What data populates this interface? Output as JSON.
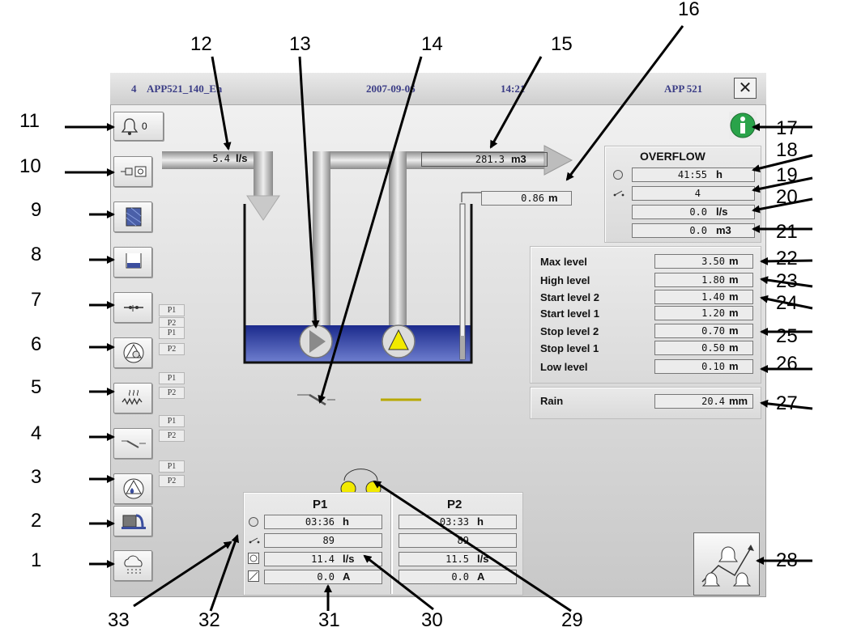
{
  "titlebar": {
    "station": "4",
    "app_name": "APP521_140_En",
    "date": "2007-09-06",
    "time": "14:21",
    "model": "APP 521",
    "close_symbol": "✕"
  },
  "alarm_count": "0",
  "side_tags": {
    "p1": "P1",
    "p2": "P2"
  },
  "flows": {
    "inflow": {
      "value": "5.4",
      "unit": "l/s"
    },
    "outflow_volume": {
      "value": "281.3",
      "unit": "m3"
    },
    "level": {
      "value": "0.86",
      "unit": "m"
    }
  },
  "overflow": {
    "title": "OVERFLOW",
    "time": {
      "value": "41:55",
      "unit": "h"
    },
    "count": {
      "value": "4",
      "unit": ""
    },
    "flow": {
      "value": "0.0",
      "unit": "l/s"
    },
    "volume": {
      "value": "0.0",
      "unit": "m3"
    }
  },
  "levels": [
    {
      "label": "Max level",
      "value": "3.50",
      "unit": "m"
    },
    {
      "label": "High level",
      "value": "1.80",
      "unit": "m"
    },
    {
      "label": "Start level 2",
      "value": "1.40",
      "unit": "m"
    },
    {
      "label": "Start level 1",
      "value": "1.20",
      "unit": "m"
    },
    {
      "label": "Stop level 2",
      "value": "0.70",
      "unit": "m"
    },
    {
      "label": "Stop level 1",
      "value": "0.50",
      "unit": "m"
    },
    {
      "label": "Low level",
      "value": "0.10",
      "unit": "m"
    }
  ],
  "rain": {
    "label": "Rain",
    "value": "20.4",
    "unit": "mm"
  },
  "pumps": [
    {
      "name": "P1",
      "runtime": {
        "value": "03:36",
        "unit": "h"
      },
      "starts": "89",
      "flow": {
        "value": "11.4",
        "unit": "l/s"
      },
      "current": {
        "value": "0.0",
        "unit": "A"
      }
    },
    {
      "name": "P2",
      "runtime": {
        "value": "03:33",
        "unit": "h"
      },
      "starts": "89",
      "flow": {
        "value": "11.5",
        "unit": "l/s"
      },
      "current": {
        "value": "0.0",
        "unit": "A"
      }
    }
  ],
  "callouts": [
    "1",
    "2",
    "3",
    "4",
    "5",
    "6",
    "7",
    "8",
    "9",
    "10",
    "11",
    "12",
    "13",
    "14",
    "15",
    "16",
    "17",
    "18",
    "19",
    "20",
    "21",
    "22",
    "23",
    "24",
    "25",
    "26",
    "27",
    "28",
    "29",
    "30",
    "31",
    "32",
    "33"
  ],
  "colors": {
    "title_text": "#3b3d86",
    "water": "#1b2a8c",
    "pump_active": "#f2ea00",
    "info_green": "#2aa34a",
    "pipe": "#bdbdbd"
  }
}
